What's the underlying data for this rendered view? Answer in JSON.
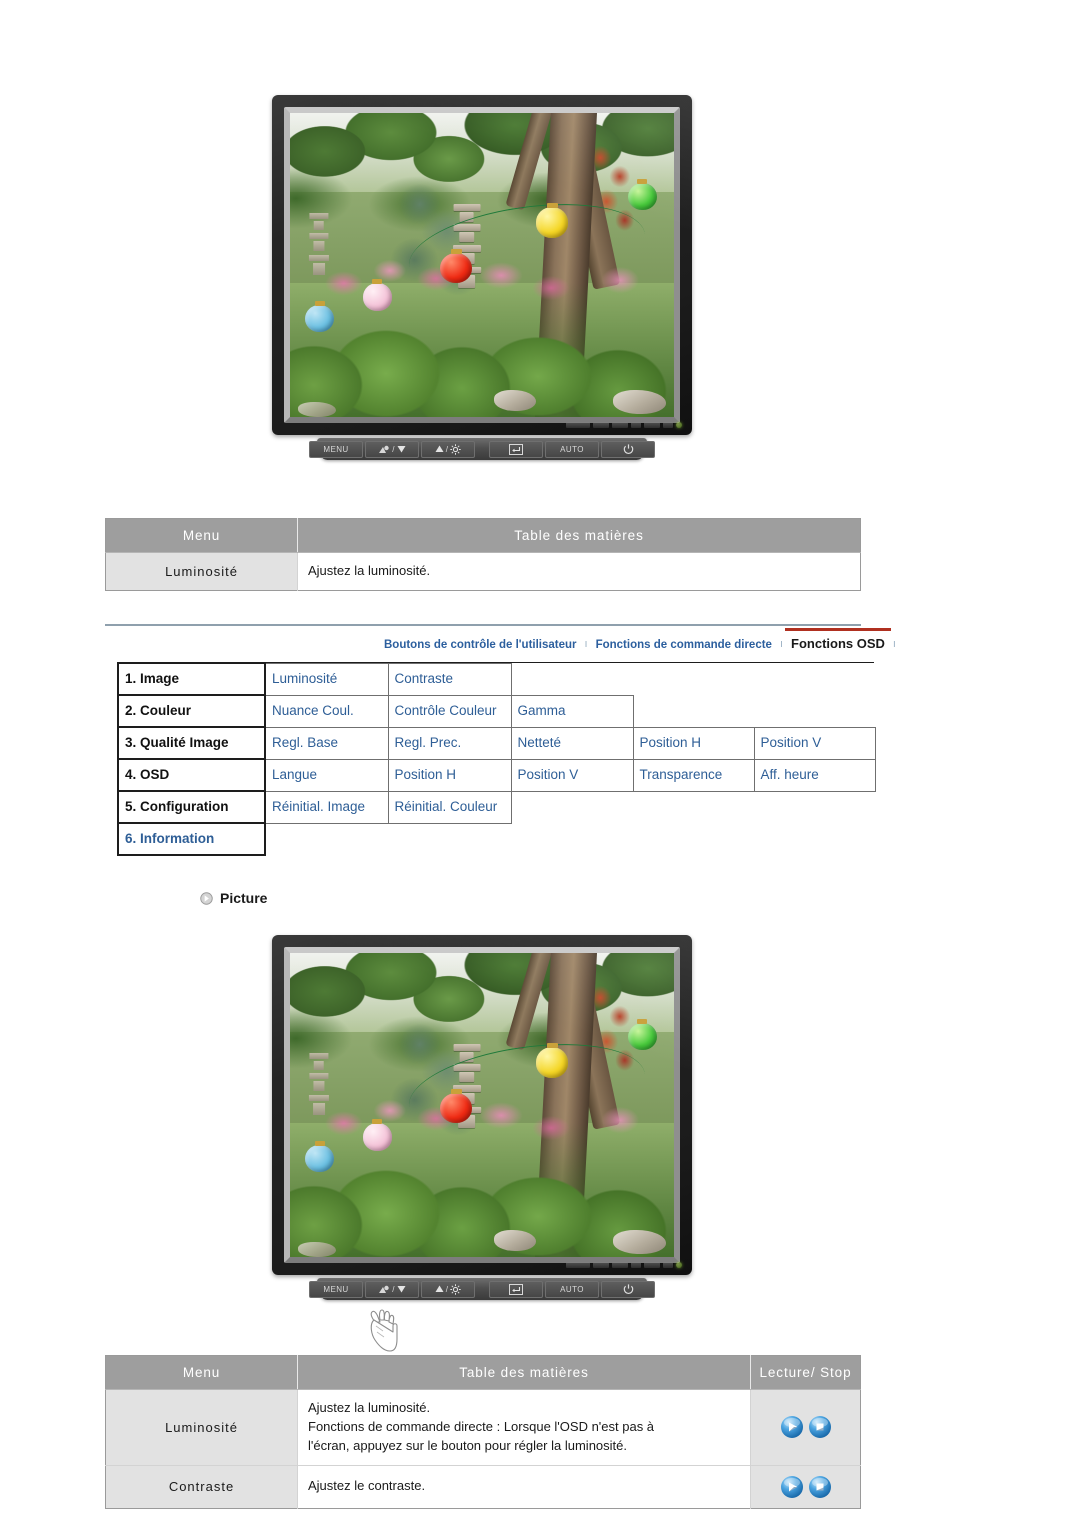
{
  "monitor_top": {
    "alt": "monitor-display-garden-photo",
    "buttons": [
      {
        "name": "menu-button",
        "label": "MENU"
      },
      {
        "name": "source-down-button",
        "label": "/"
      },
      {
        "name": "up-brightness-button",
        "label": "/"
      },
      {
        "name": "enter-button",
        "label": ""
      },
      {
        "name": "auto-button",
        "label": "AUTO"
      },
      {
        "name": "power-button",
        "label": ""
      }
    ]
  },
  "table_top": {
    "headers": [
      "Menu",
      "Table des matières"
    ],
    "rows": [
      {
        "menu": "Luminosité",
        "desc": "Ajustez la luminosité."
      }
    ]
  },
  "navbar": {
    "items": [
      {
        "label": "Boutons de contrôle de l'utilisateur",
        "active": false
      },
      {
        "label": "Fonctions de commande directe",
        "active": false
      },
      {
        "label": "Fonctions OSD",
        "active": true
      }
    ],
    "separator": "ı",
    "accent_color": "#b03020",
    "link_color": "#2c5f9e"
  },
  "osd_map": {
    "rows": [
      {
        "level1": "1. Image",
        "children": [
          "Luminosité",
          "Contraste"
        ]
      },
      {
        "level1": "2. Couleur",
        "children": [
          "Nuance Coul.",
          "Contrôle Couleur",
          "Gamma"
        ]
      },
      {
        "level1": "3. Qualité Image",
        "children": [
          "Regl. Base",
          "Regl. Prec.",
          "Netteté",
          "Position H",
          "Position V"
        ]
      },
      {
        "level1": "4. OSD",
        "children": [
          "Langue",
          "Position H",
          "Position V",
          "Transparence",
          "Aff. heure"
        ]
      },
      {
        "level1": "5. Configuration",
        "children": [
          "Réinitial. Image",
          "Réinitial. Couleur"
        ]
      },
      {
        "level1": "6. Information",
        "children": [],
        "highlight": true
      }
    ]
  },
  "section": {
    "title": "Picture",
    "icon": "circle-arrow-icon"
  },
  "monitor_bottom": {
    "alt": "monitor-display-garden-photo",
    "cursor": "hand-pointer-icon",
    "buttons": [
      {
        "name": "menu-button",
        "label": "MENU"
      },
      {
        "name": "source-down-button",
        "label": "/"
      },
      {
        "name": "up-brightness-button",
        "label": "/"
      },
      {
        "name": "enter-button",
        "label": ""
      },
      {
        "name": "auto-button",
        "label": "AUTO"
      },
      {
        "name": "power-button",
        "label": ""
      }
    ]
  },
  "table_bottom": {
    "headers": [
      "Menu",
      "Table des matières",
      "Lecture/ Stop"
    ],
    "rows": [
      {
        "menu": "Luminosité",
        "desc_line1": "Ajustez la luminosité.",
        "desc_line2": "Fonctions de commande directe : Lorsque l'OSD n'est pas à",
        "desc_line3": "l'écran, appuyez sur le bouton pour régler la luminosité.",
        "controls": [
          "play-icon",
          "stop-icon"
        ]
      },
      {
        "menu": "Contraste",
        "desc_line1": "Ajustez le contraste.",
        "desc_line2": "",
        "desc_line3": "",
        "controls": [
          "play-icon",
          "stop-icon"
        ]
      }
    ]
  }
}
